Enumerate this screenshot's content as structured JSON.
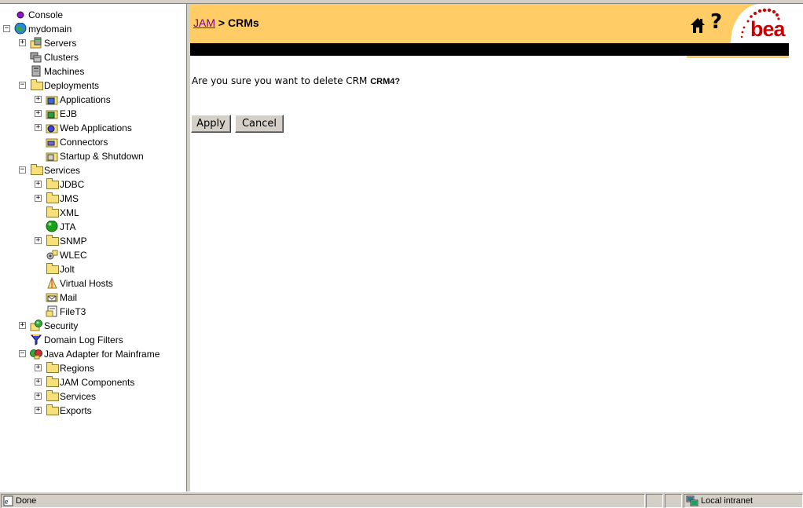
{
  "tree": {
    "items": [
      {
        "label": "Console",
        "exp": null,
        "icon": "console-orb-icon"
      },
      {
        "label": "mydomain",
        "exp": "−",
        "icon": "globe-icon"
      },
      {
        "label": "Servers",
        "exp": "+",
        "icon": "servers-icon"
      },
      {
        "label": "Clusters",
        "exp": null,
        "icon": "clusters-icon"
      },
      {
        "label": "Machines",
        "exp": null,
        "icon": "machines-icon"
      },
      {
        "label": "Deployments",
        "exp": "−",
        "icon": "folder-icon"
      },
      {
        "label": "Applications",
        "exp": "+",
        "icon": "applications-icon"
      },
      {
        "label": "EJB",
        "exp": "+",
        "icon": "ejb-icon"
      },
      {
        "label": "Web Applications",
        "exp": "+",
        "icon": "web-applications-icon"
      },
      {
        "label": "Connectors",
        "exp": null,
        "icon": "connectors-icon"
      },
      {
        "label": "Startup & Shutdown",
        "exp": null,
        "icon": "startup-shutdown-icon"
      },
      {
        "label": "Services",
        "exp": "−",
        "icon": "folder-icon"
      },
      {
        "label": "JDBC",
        "exp": "+",
        "icon": "folder-icon"
      },
      {
        "label": "JMS",
        "exp": "+",
        "icon": "folder-icon"
      },
      {
        "label": "XML",
        "exp": null,
        "icon": "folder-icon"
      },
      {
        "label": "JTA",
        "exp": null,
        "icon": "green-orb-icon"
      },
      {
        "label": "SNMP",
        "exp": "+",
        "icon": "folder-icon"
      },
      {
        "label": "WLEC",
        "exp": null,
        "icon": "wlec-icon"
      },
      {
        "label": "Jolt",
        "exp": null,
        "icon": "folder-icon"
      },
      {
        "label": "Virtual Hosts",
        "exp": null,
        "icon": "virtual-hosts-icon"
      },
      {
        "label": "Mail",
        "exp": null,
        "icon": "mail-icon"
      },
      {
        "label": "FileT3",
        "exp": null,
        "icon": "filet3-icon"
      },
      {
        "label": "Security",
        "exp": "+",
        "icon": "security-icon"
      },
      {
        "label": "Domain Log Filters",
        "exp": null,
        "icon": "funnel-icon"
      },
      {
        "label": "Java Adapter for Mainframe",
        "exp": "−",
        "icon": "jam-icon"
      },
      {
        "label": "Regions",
        "exp": "+",
        "icon": "folder-icon"
      },
      {
        "label": "JAM Components",
        "exp": "+",
        "icon": "folder-icon"
      },
      {
        "label": "Services",
        "exp": "+",
        "icon": "folder-icon"
      },
      {
        "label": "Exports",
        "exp": "+",
        "icon": "folder-icon"
      }
    ]
  },
  "header": {
    "crumb_link": "JAM",
    "crumb_sep": " > ",
    "crumb_current": "CRMs",
    "help_glyph": "?",
    "logo_text": "bea"
  },
  "main": {
    "message_prefix": "Are you sure you want to delete CRM ",
    "crm_name": "CRM4?",
    "apply_label": "Apply",
    "cancel_label": "Cancel"
  },
  "status": {
    "text": "Done",
    "zone": "Local intranet"
  },
  "colors": {
    "banner": "#ffcc66",
    "link_visited": "#800080",
    "logo_red": "#cc0000"
  }
}
